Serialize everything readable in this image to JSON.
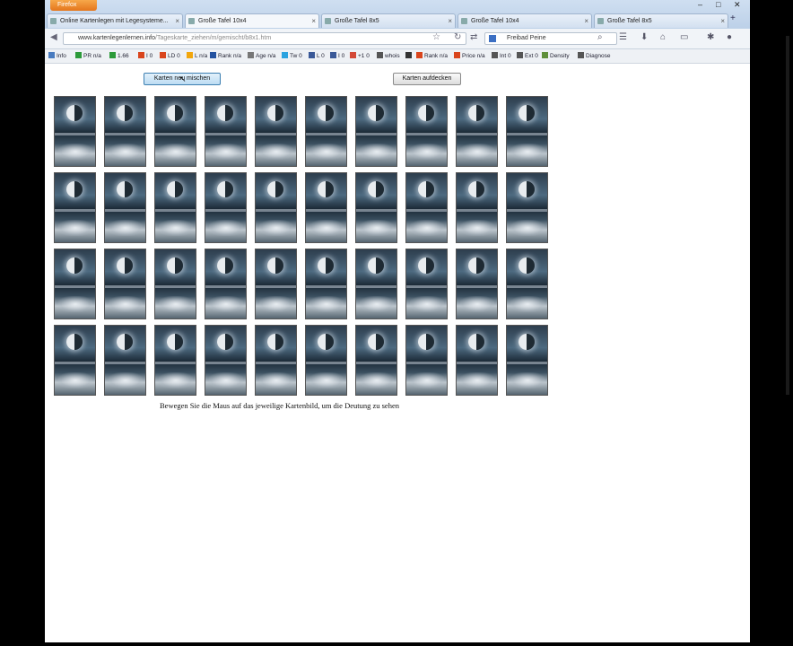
{
  "browser": {
    "app_button": "Firefox",
    "tabs": [
      {
        "label": "Online Kartenlegen mit Legesysteme..."
      },
      {
        "label": "Große Tafel 10x4"
      },
      {
        "label": "Große Tafel 8x5"
      },
      {
        "label": "Große Tafel 10x4"
      },
      {
        "label": "Große Tafel 8x5"
      }
    ],
    "new_tab": "+",
    "url_host": "www.kartenlegenlernen.info",
    "url_path": "/Tageskarte_ziehen/m/gemischt/b8x1.htm",
    "search_engine": "Freibad Peine",
    "addons": [
      {
        "label": "Info",
        "color": "#4a7cc0"
      },
      {
        "label": "PR n/a",
        "color": "#2c9a3a"
      },
      {
        "label": "1.66",
        "color": "#2c9a3a"
      },
      {
        "label": "I 0",
        "color": "#d9451d"
      },
      {
        "label": "LD 0",
        "color": "#d9451d"
      },
      {
        "label": "L n/a",
        "color": "#f2a60c"
      },
      {
        "label": "Rank n/a",
        "color": "#2452a0"
      },
      {
        "label": "Age n/a",
        "color": "#777777"
      },
      {
        "label": "Tw 0",
        "color": "#2aa3e0"
      },
      {
        "label": "L 0",
        "color": "#3a5998"
      },
      {
        "label": "I 0",
        "color": "#3a5998"
      },
      {
        "label": "+1 0",
        "color": "#d34836"
      },
      {
        "label": "whois",
        "color": "#555555"
      },
      {
        "label": "",
        "color": "#333333"
      },
      {
        "label": "Rank n/a",
        "color": "#d9451d"
      },
      {
        "label": "Price n/a",
        "color": "#d9451d"
      },
      {
        "label": "Int 0",
        "color": "#555555"
      },
      {
        "label": "Ext 0",
        "color": "#555555"
      },
      {
        "label": "Density",
        "color": "#5f8f3a"
      },
      {
        "label": "Diagnose",
        "color": "#555555"
      }
    ]
  },
  "page": {
    "shuffle_button": "Karten neu mischen",
    "reveal_button": "Karten aufdecken",
    "card_rows": 4,
    "card_cols": 10,
    "hint": "Bewegen Sie die Maus auf das jeweilige Kartenbild, um die Deutung zu sehen"
  }
}
